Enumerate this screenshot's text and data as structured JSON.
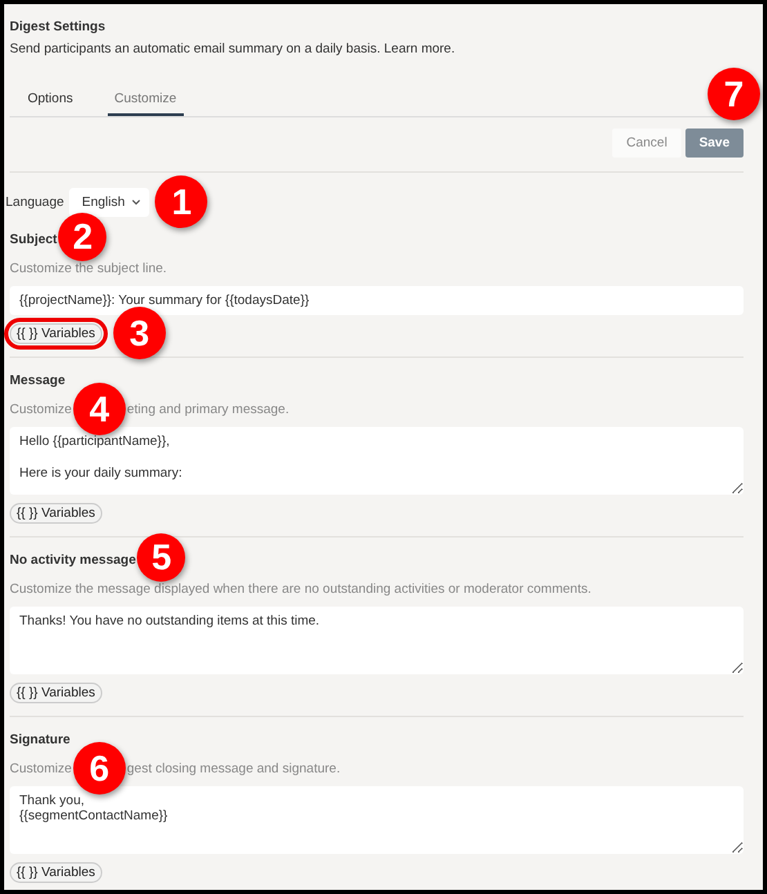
{
  "header": {
    "title": "Digest Settings",
    "subtitle": "Send participants an automatic email summary on a daily basis. Learn more."
  },
  "tabs": [
    {
      "label": "Options",
      "selected": false
    },
    {
      "label": "Customize",
      "selected": true
    }
  ],
  "actions": [
    {
      "label": "Cancel",
      "kind": "secondary"
    },
    {
      "label": "Save",
      "kind": "primary"
    }
  ],
  "actions_callout": "7",
  "language": {
    "label": "Language",
    "value": "English",
    "callout": "1"
  },
  "sections": [
    {
      "title": "Subject",
      "description_parts": [
        "Customize the subject line."
      ],
      "callout": "2",
      "kind": "line",
      "value": "{{projectName}}: Your summary for {{todaysDate}}",
      "variables_button": {
        "label": "{{ }} Variables",
        "highlighted": true,
        "callout": "3"
      }
    },
    {
      "title": "Message",
      "description_parts": [
        "Customize",
        "eting and primary message."
      ],
      "callout": "4",
      "kind": "area",
      "value": "Hello {{participantName}},\n\nHere is your daily summary:",
      "variables_button": {
        "label": "{{ }} Variables",
        "highlighted": false
      }
    },
    {
      "title": "No activity message",
      "description_parts": [
        "Customize the message displayed when there are no outstanding activities or moderator comments."
      ],
      "callout": "5",
      "kind": "area",
      "value": "Thanks! You have no outstanding items at this time.",
      "variables_button": {
        "label": "{{ }} Variables",
        "highlighted": false
      }
    },
    {
      "title": "Signature",
      "description_parts": [
        "Customize",
        "gest closing message and signature."
      ],
      "callout": "6",
      "kind": "area",
      "value": "Thank you,\n{{segmentContactName}}",
      "variables_button": {
        "label": "{{ }} Variables",
        "highlighted": false
      }
    }
  ]
}
